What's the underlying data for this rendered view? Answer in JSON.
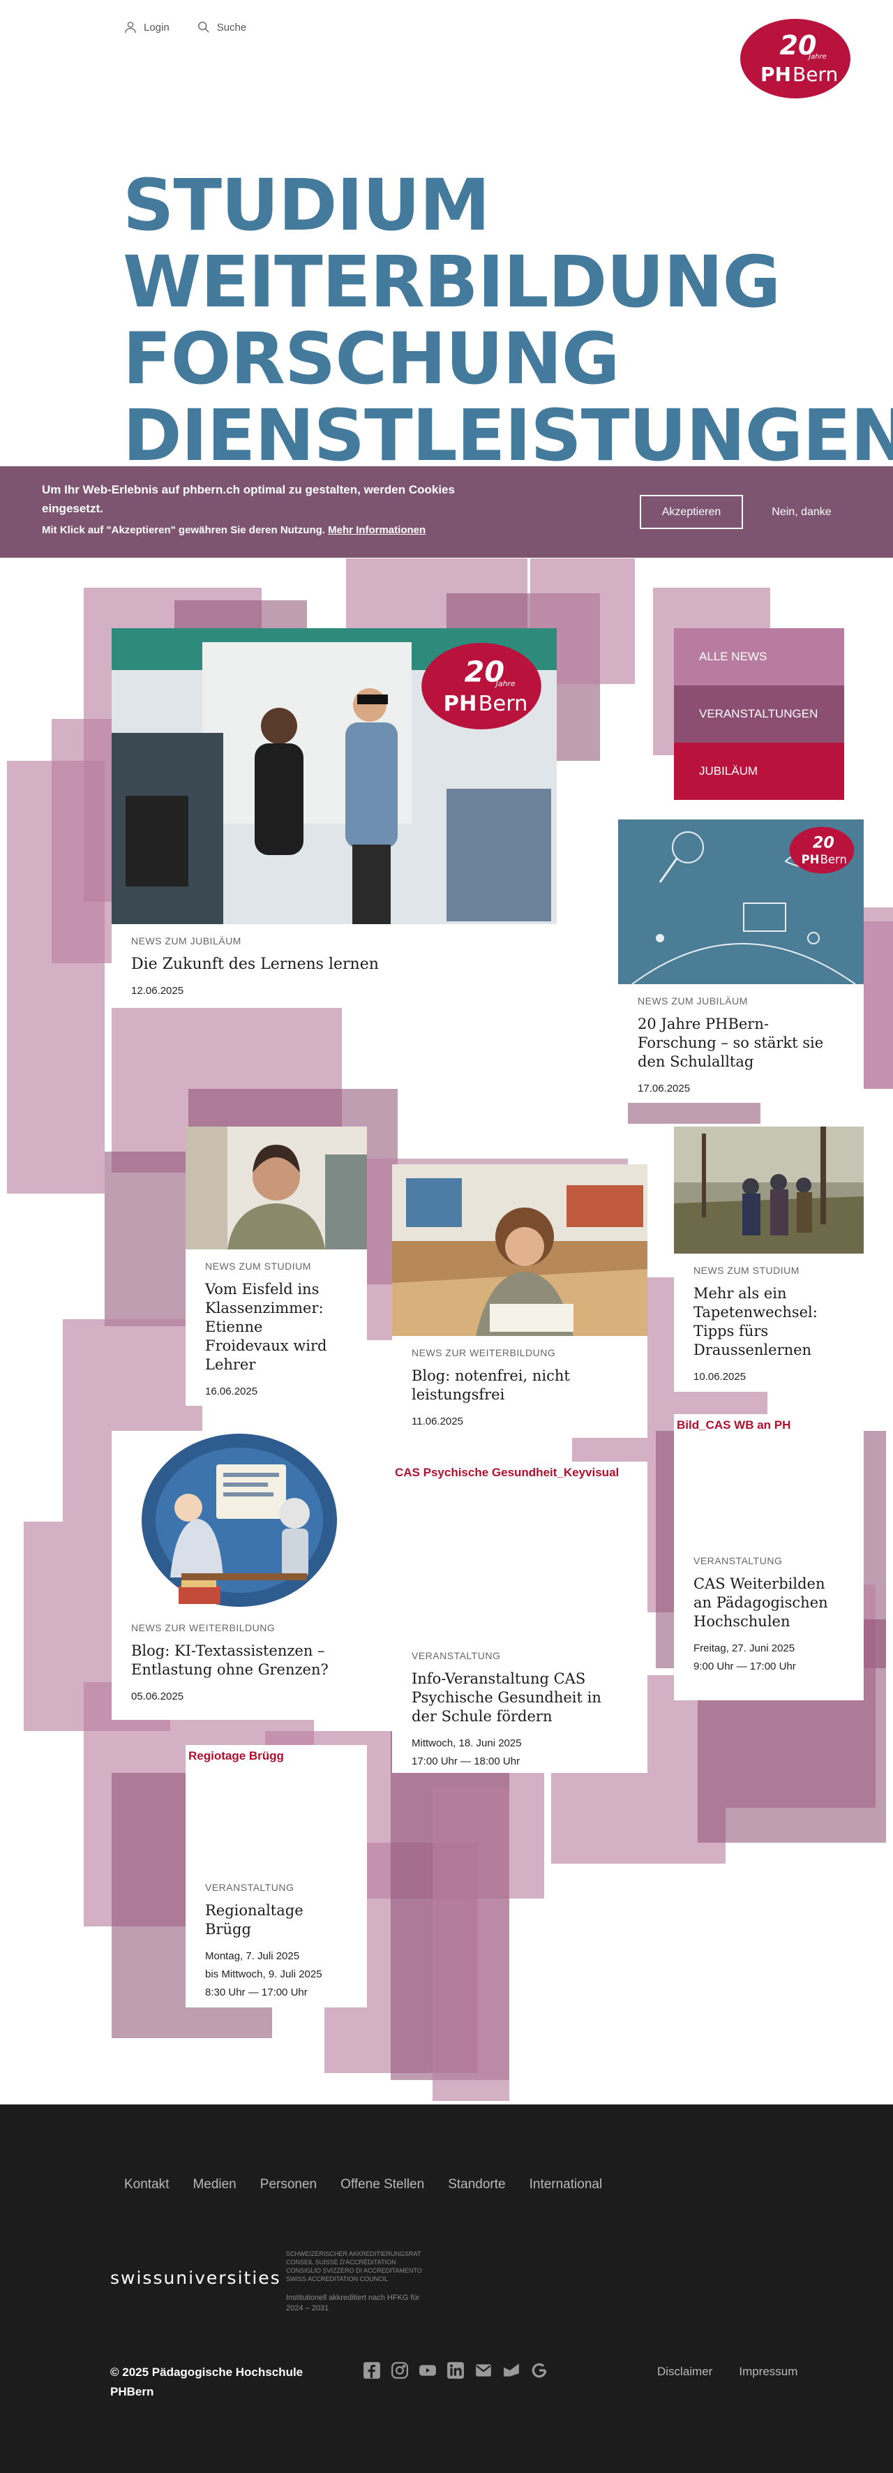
{
  "header": {
    "login_label": "Login",
    "search_label": "Suche",
    "logo": {
      "line1": "20",
      "line2": "Jahre",
      "brand_a": "PH",
      "brand_b": "Bern"
    }
  },
  "hero": {
    "lines": [
      "STUDIUM",
      "WEITERBILDUNG",
      "FORSCHUNG",
      "DIENSTLEISTUNGEN"
    ]
  },
  "cookie": {
    "text": "Um Ihr Web-Erlebnis auf phbern.ch optimal zu gestalten, werden Cookies eingesetzt.",
    "sub": "Mit Klick auf \"Akzeptieren\" gewähren Sie deren Nutzung.",
    "more_link": "Mehr Informationen",
    "accept": "Akzeptieren",
    "deny": "Nein, danke"
  },
  "filters": [
    "ALLE NEWS",
    "VERANSTALTUNGEN",
    "JUBILÄUM"
  ],
  "cards": [
    {
      "category": "NEWS ZUM JUBILÄUM",
      "title": "Die Zukunft des Lernens lernen",
      "date": "12.06.2025"
    },
    {
      "category": "NEWS ZUM JUBILÄUM",
      "title": "20 Jahre PHBern-Forschung – so stärkt sie den Schulalltag",
      "date": "17.06.2025"
    },
    {
      "category": "NEWS ZUM STUDIUM",
      "title": "Vom Eisfeld ins Klassenzimmer: Etienne Froidevaux wird Lehrer",
      "date": "16.06.2025"
    },
    {
      "category": "NEWS ZUR WEITERBILDUNG",
      "title": "Blog: notenfrei, nicht leistungsfrei",
      "date": "11.06.2025"
    },
    {
      "category": "NEWS ZUM STUDIUM",
      "title": "Mehr als ein Tapetenwechsel: Tipps fürs Draussenlernen",
      "date": "10.06.2025"
    },
    {
      "category": "NEWS ZUR WEITERBILDUNG",
      "title": "Blog: KI-Textassistenzen – Entlastung ohne Grenzen?",
      "date": "05.06.2025"
    },
    {
      "alt": "CAS Psychische Gesundheit_Keyvisual",
      "category": "VERANSTALTUNG",
      "title": "Info-Veranstaltung CAS Psychische Gesundheit in der Schule fördern",
      "date_lines": [
        "Mittwoch, 18. Juni 2025",
        "17:00 Uhr — 18:00 Uhr"
      ]
    },
    {
      "alt": "Bild_CAS WB an PH",
      "category": "VERANSTALTUNG",
      "title": "CAS Weiterbilden an Pädagogischen Hochschulen",
      "date_lines": [
        "Freitag, 27. Juni 2025",
        "9:00 Uhr — 17:00 Uhr"
      ]
    },
    {
      "alt": "Regiotage Brügg",
      "category": "VERANSTALTUNG",
      "title": "Regionaltage Brügg",
      "date_lines": [
        "Montag, 7. Juli 2025",
        "bis Mittwoch, 9. Juli 2025",
        "8:30 Uhr — 17:00 Uhr"
      ]
    }
  ],
  "footer": {
    "nav": [
      "Kontakt",
      "Medien",
      "Personen",
      "Offene Stellen",
      "Standorte",
      "International"
    ],
    "swissu": "swissuniversities",
    "accreditation": [
      "SCHWEIZERISCHER AKKREDITIERUNGSRAT",
      "CONSEIL SUISSE D'ACCRÉDITATION",
      "CONSIGLIO SVIZZERO DI ACCREDITAMENTO",
      "SWISS ACCREDITATION COUNCIL"
    ],
    "accr_note": "Institutionell akkreditiert nach HFKG für 2024 – 2031",
    "copyright_line1": "© 2025 Pädagogische Hochschule",
    "copyright_line2": "PHBern",
    "social_icons": [
      "facebook-icon",
      "instagram-icon",
      "youtube-icon",
      "linkedin-icon",
      "newsletter-icon",
      "blog-icon",
      "google-icon"
    ],
    "legal": [
      "Disclaimer",
      "Impressum"
    ]
  },
  "colors": {
    "hero_blue": "#447b9c",
    "cookie_bg": "#7e5571",
    "mauve": "#b9809f",
    "plum": "#8c4f72",
    "crimson": "#b8123d",
    "footer_bg": "#1c1c1c"
  }
}
